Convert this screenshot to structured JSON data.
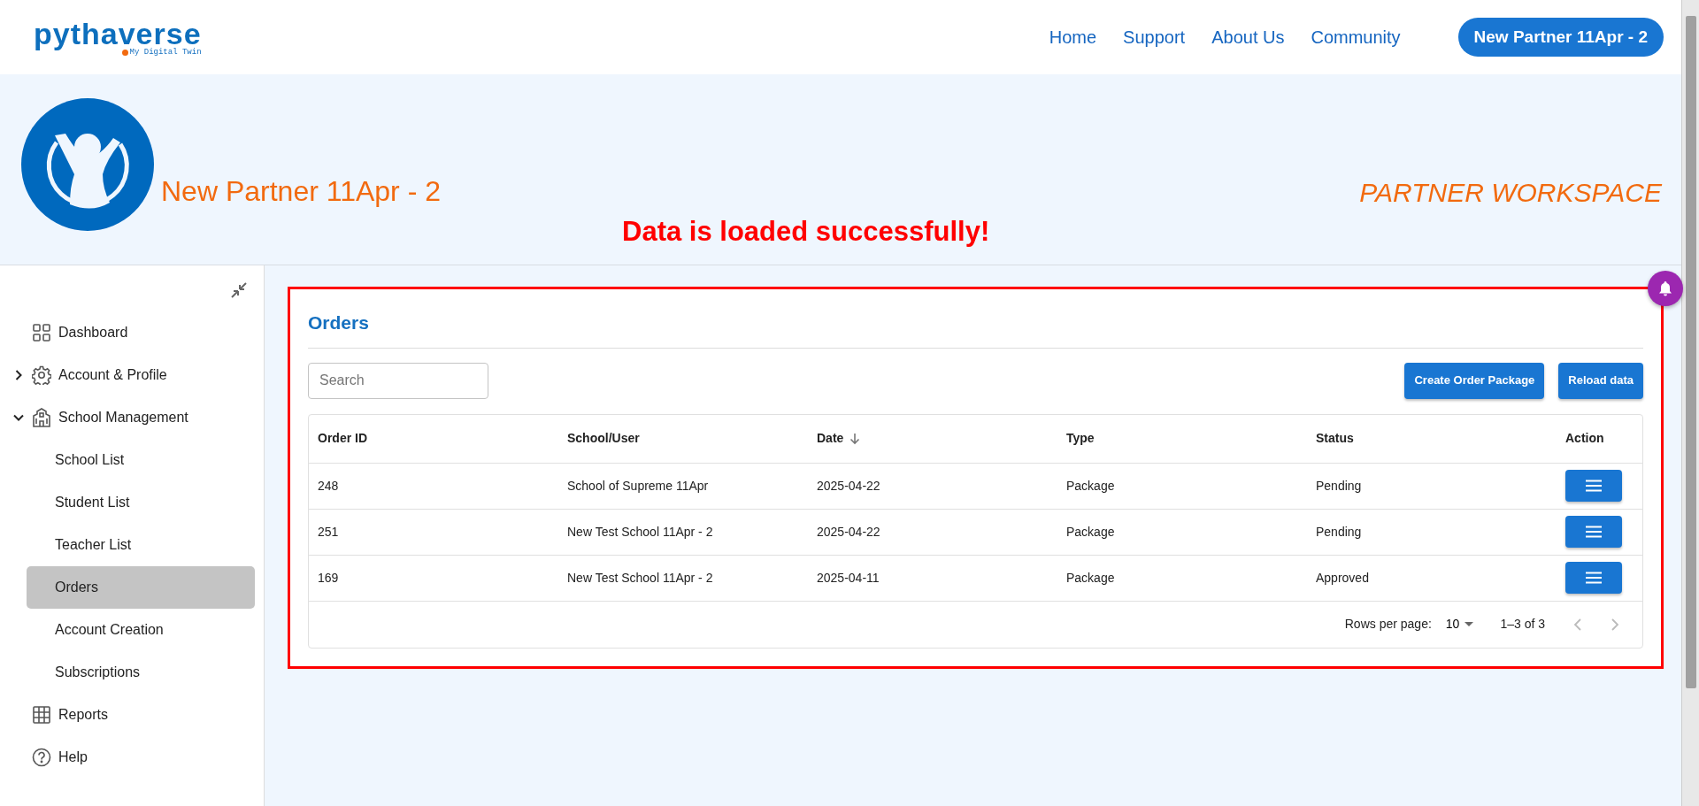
{
  "header": {
    "logo": {
      "name": "pythaverse",
      "tagline": "My Digital Twin"
    },
    "nav": [
      {
        "label": "Home"
      },
      {
        "label": "Support"
      },
      {
        "label": "About Us"
      },
      {
        "label": "Community"
      }
    ],
    "account_button": "New Partner 11Apr - 2"
  },
  "banner": {
    "partner_name": "New Partner 11Apr - 2",
    "message": "Data is loaded successfully!",
    "workspace": "PARTNER WORKSPACE"
  },
  "sidebar": {
    "items": [
      {
        "label": "Dashboard",
        "selected": false
      },
      {
        "label": "Account & Profile",
        "selected": false,
        "expanded": false
      },
      {
        "label": "School Management",
        "selected": false,
        "expanded": true,
        "children": [
          {
            "label": "School List",
            "selected": false
          },
          {
            "label": "Student List",
            "selected": false
          },
          {
            "label": "Teacher List",
            "selected": false
          },
          {
            "label": "Orders",
            "selected": true
          },
          {
            "label": "Account Creation",
            "selected": false
          },
          {
            "label": "Subscriptions",
            "selected": false
          }
        ]
      },
      {
        "label": "Reports",
        "selected": false
      },
      {
        "label": "Help",
        "selected": false
      }
    ]
  },
  "orders": {
    "title": "Orders",
    "search": {
      "placeholder": "Search"
    },
    "buttons": [
      "Create Order Package",
      "Reload data"
    ],
    "table": {
      "columns": [
        {
          "label": "Order ID",
          "sorted": false
        },
        {
          "label": "School/User",
          "sorted": false
        },
        {
          "label": "Date",
          "sorted": true
        },
        {
          "label": "Type",
          "sorted": false
        },
        {
          "label": "Status",
          "sorted": false
        },
        {
          "label": "Action",
          "sorted": false
        }
      ],
      "rows": [
        [
          "248",
          "School of Supreme 11Apr",
          "2025-04-22",
          "Package",
          "Pending"
        ],
        [
          "251",
          "New Test School 11Apr - 2",
          "2025-04-22",
          "Package",
          "Pending"
        ],
        [
          "169",
          "New Test School 11Apr - 2",
          "2025-04-11",
          "Package",
          "Approved"
        ]
      ]
    },
    "pagination": {
      "rows_per_page_label": "Rows per page:",
      "rows_per_page": "10",
      "range": "1–3 of 3"
    }
  }
}
